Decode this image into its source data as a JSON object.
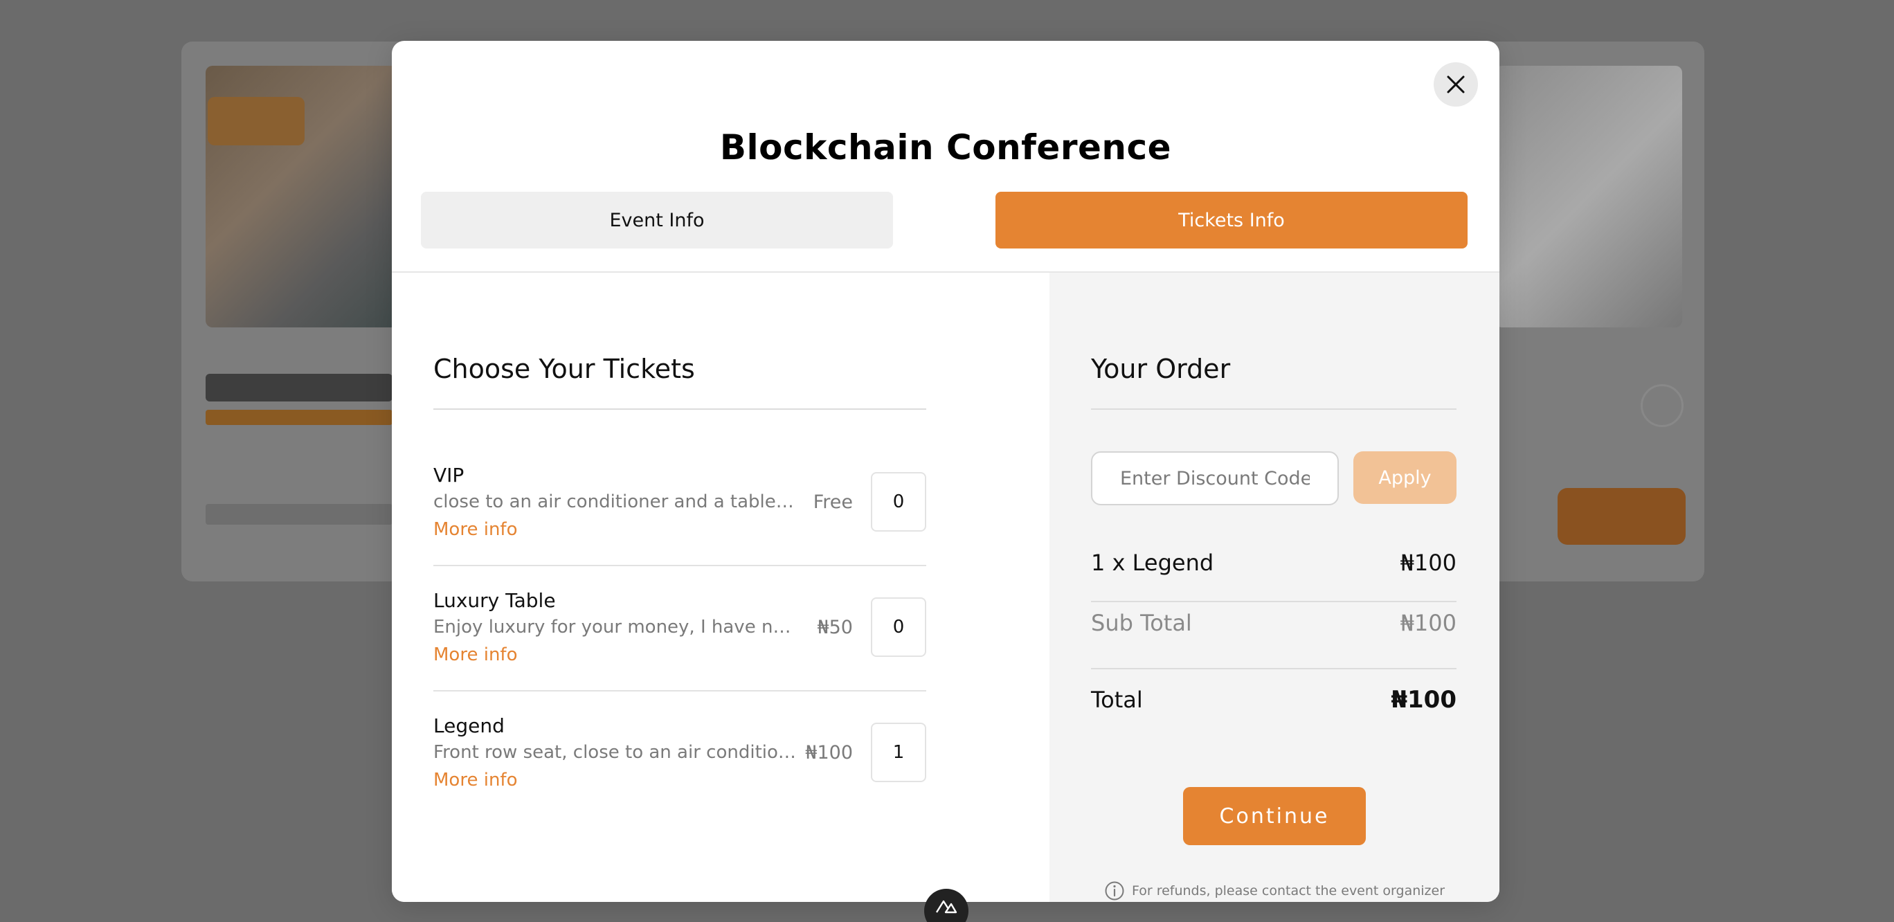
{
  "modal": {
    "title": "Blockchain Conference",
    "close_icon": "close-icon"
  },
  "tabs": [
    {
      "label": "Event Info",
      "active": false
    },
    {
      "label": "Tickets Info",
      "active": true
    }
  ],
  "tickets_section": {
    "heading": "Choose Your Tickets",
    "items": [
      {
        "name": "VIP",
        "description": "close to an air conditioner and a table full of food",
        "more_info": "More info",
        "price": "Free",
        "quantity": "0"
      },
      {
        "name": "Luxury Table",
        "description": "Enjoy luxury for your money, I have never seen anything like it",
        "more_info": "More info",
        "price": "₦50",
        "quantity": "0"
      },
      {
        "name": "Legend",
        "description": "Front row seat, close to an air conditioner and a table",
        "more_info": "More info",
        "price": "₦100",
        "quantity": "1"
      }
    ]
  },
  "order": {
    "heading": "Your Order",
    "discount_placeholder": "Enter Discount Code",
    "apply_label": "Apply",
    "line_item": {
      "label": "1 x Legend",
      "amount": "₦100"
    },
    "subtotal": {
      "label": "Sub Total",
      "amount": "₦100"
    },
    "total": {
      "label": "Total",
      "amount": "₦100"
    },
    "continue_label": "Continue",
    "refund_note": "For refunds, please contact the event organizer"
  },
  "colors": {
    "accent": "#e58432",
    "accent_light": "#f2c296",
    "overlay": "#6b6b6b"
  },
  "icons": {
    "close": "close-icon",
    "info": "info-icon",
    "logo": "nuxt-logo-icon"
  }
}
